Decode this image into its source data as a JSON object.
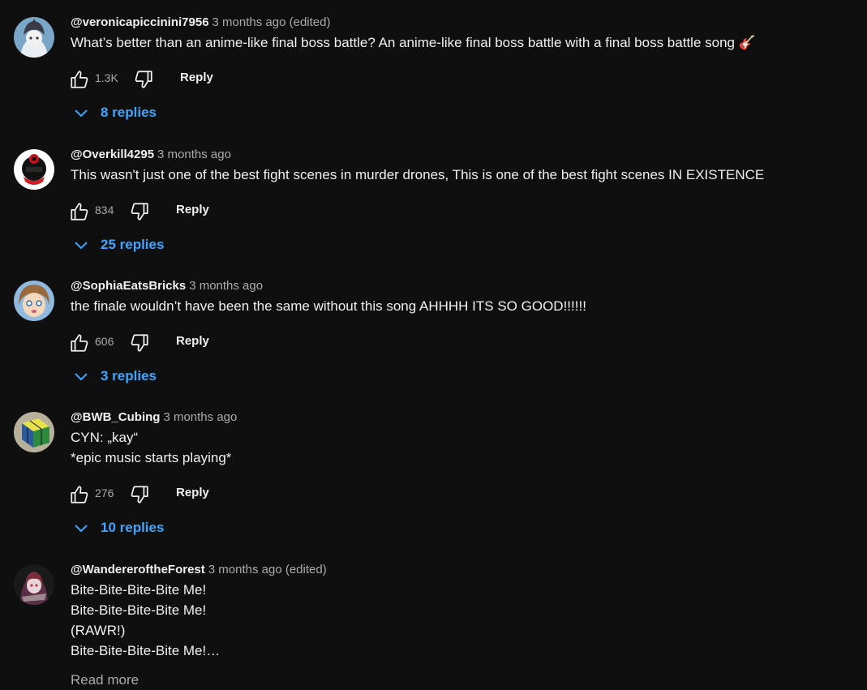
{
  "comments": [
    {
      "author": "@veronicapiccinini7956",
      "meta": "3 months ago (edited)",
      "text": "What’s better than an anime-like final boss battle? An anime-like final boss battle with a final boss battle song 🎸",
      "likes": "1.3K",
      "reply_label": "Reply",
      "replies_label": "8 replies",
      "avatar_icon": "avatar-icon"
    },
    {
      "author": "@Overkill4295",
      "meta": "3 months ago",
      "text": "This wasn't just one of the best fight scenes in murder drones, This is one of the best fight scenes IN EXISTENCE",
      "likes": "834",
      "reply_label": "Reply",
      "replies_label": "25 replies"
    },
    {
      "author": "@SophiaEatsBricks",
      "meta": "3 months ago",
      "text": "the finale wouldn’t have been the same without this song AHHHH ITS SO GOOD!!!!!!",
      "likes": "606",
      "reply_label": "Reply",
      "replies_label": "3 replies"
    },
    {
      "author": "@BWB_Cubing",
      "meta": "3 months ago",
      "text": "CYN: „kay“\n*epic music starts playing*",
      "likes": "276",
      "reply_label": "Reply",
      "replies_label": "10 replies"
    },
    {
      "author": "@WandereroftheForest",
      "meta": "3 months ago (edited)",
      "text": "Bite-Bite-Bite-Bite Me!\nBite-Bite-Bite-Bite Me!\n(RAWR!)\nBite-Bite-Bite-Bite Me!…",
      "read_more": "Read more"
    }
  ],
  "colors": {
    "background": "#0f0f0f",
    "text": "#f1f1f1",
    "secondary_text": "#aaaaaa",
    "link_blue": "#3ea6ff"
  },
  "icons": [
    "thumbs-up-icon",
    "thumbs-down-icon",
    "chevron-down-icon"
  ]
}
